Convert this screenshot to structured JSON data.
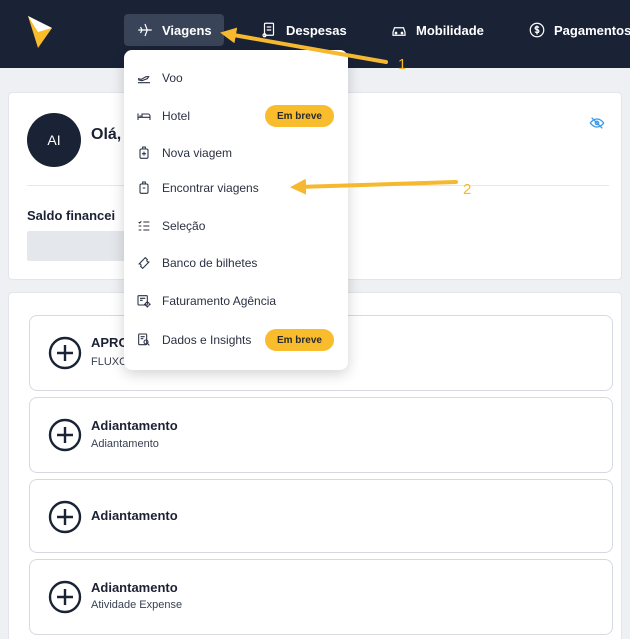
{
  "nav": {
    "items": [
      {
        "label": "Viagens",
        "icon": "plane-icon",
        "active": true
      },
      {
        "label": "Despesas",
        "icon": "receipt-icon"
      },
      {
        "label": "Mobilidade",
        "icon": "car-icon"
      },
      {
        "label": "Pagamentos",
        "icon": "dollar-circle-icon"
      }
    ]
  },
  "profile": {
    "avatar_initials": "AI",
    "greeting": "Olá,",
    "saldo_label": "Saldo financei"
  },
  "dropdown": {
    "items": [
      {
        "label": "Voo",
        "icon": "flight-takeoff-icon"
      },
      {
        "label": "Hotel",
        "icon": "bed-icon",
        "badge": "Em breve"
      },
      {
        "label": "Nova viagem",
        "icon": "luggage-add-icon"
      },
      {
        "label": "Encontrar viagens",
        "icon": "luggage-icon"
      },
      {
        "label": "Seleção",
        "icon": "checklist-icon"
      },
      {
        "label": "Banco de bilhetes",
        "icon": "ticket-icon"
      },
      {
        "label": "Faturamento Agência",
        "icon": "billing-gear-icon"
      },
      {
        "label": "Dados e Insights",
        "icon": "insights-icon",
        "badge": "Em breve"
      }
    ]
  },
  "list": {
    "items": [
      {
        "title": "APRO",
        "subtitle": "FLUXO"
      },
      {
        "title": "Adiantamento",
        "subtitle": "Adiantamento"
      },
      {
        "title": "Adiantamento",
        "subtitle": ""
      },
      {
        "title": "Adiantamento",
        "subtitle": "Atividade Expense"
      }
    ]
  },
  "annotations": {
    "first": "1",
    "second": "2"
  },
  "colors": {
    "nav_bg": "#1a2236",
    "accent": "#f9bc2c",
    "annotation": "#f5b82e"
  }
}
